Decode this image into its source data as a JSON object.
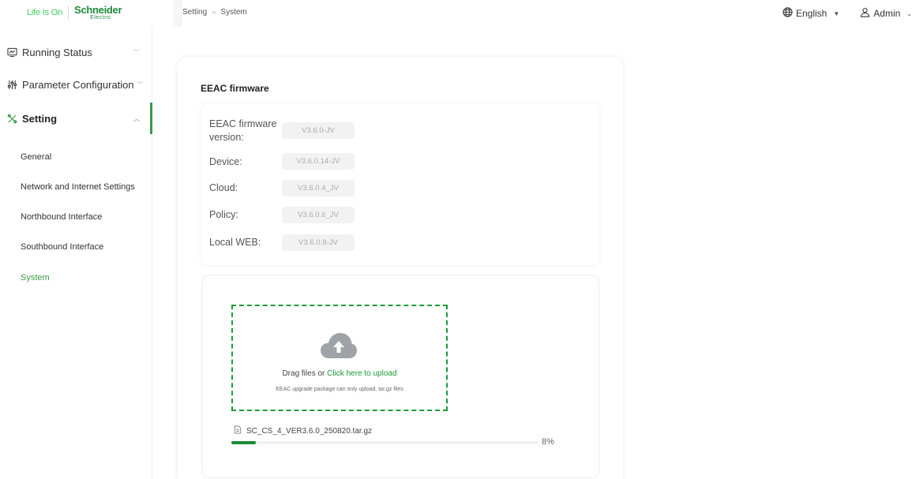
{
  "header": {
    "logo_tagline": "Life Is On",
    "logo_brand": "Schneider",
    "logo_sub": "Electric",
    "breadcrumb": [
      "Setting",
      "System"
    ],
    "language": "English",
    "user": "Admin"
  },
  "sidebar": {
    "groups": [
      {
        "label": "Running Status",
        "icon": "monitor-icon"
      },
      {
        "label": "Parameter Configuration",
        "icon": "sliders-icon"
      },
      {
        "label": "Setting",
        "icon": "tools-icon"
      }
    ],
    "sub_items": [
      "General",
      "Network and Internet Settings",
      "Northbound Interface",
      "Southbound Interface",
      "System"
    ],
    "selected": "System"
  },
  "firmware": {
    "title": "EEAC firmware",
    "rows": [
      {
        "label": "EEAC firmware version:",
        "value": "V3.6.0-JV"
      },
      {
        "label": "Device:",
        "value": "V3.6.0.14-JV"
      },
      {
        "label": "Cloud:",
        "value": "V3.6.0.4_JV"
      },
      {
        "label": "Policy:",
        "value": "V3.6.0.6_JV"
      },
      {
        "label": "Local WEB:",
        "value": "V3.6.0.8-JV"
      }
    ]
  },
  "upload": {
    "drag_prefix": "Drag files or ",
    "drag_link": "Click here to upload",
    "hint": "EEAC upgrade package can only upload. tar.gz files",
    "file_name": "SC_CS_4_VER3.6.0_250820.tar.gz",
    "progress": 0.08,
    "progress_text": "8%"
  },
  "colors": {
    "accent": "#3a9a46",
    "dropzone_border": "#1a9c3a",
    "progress": "#1a8c34"
  }
}
